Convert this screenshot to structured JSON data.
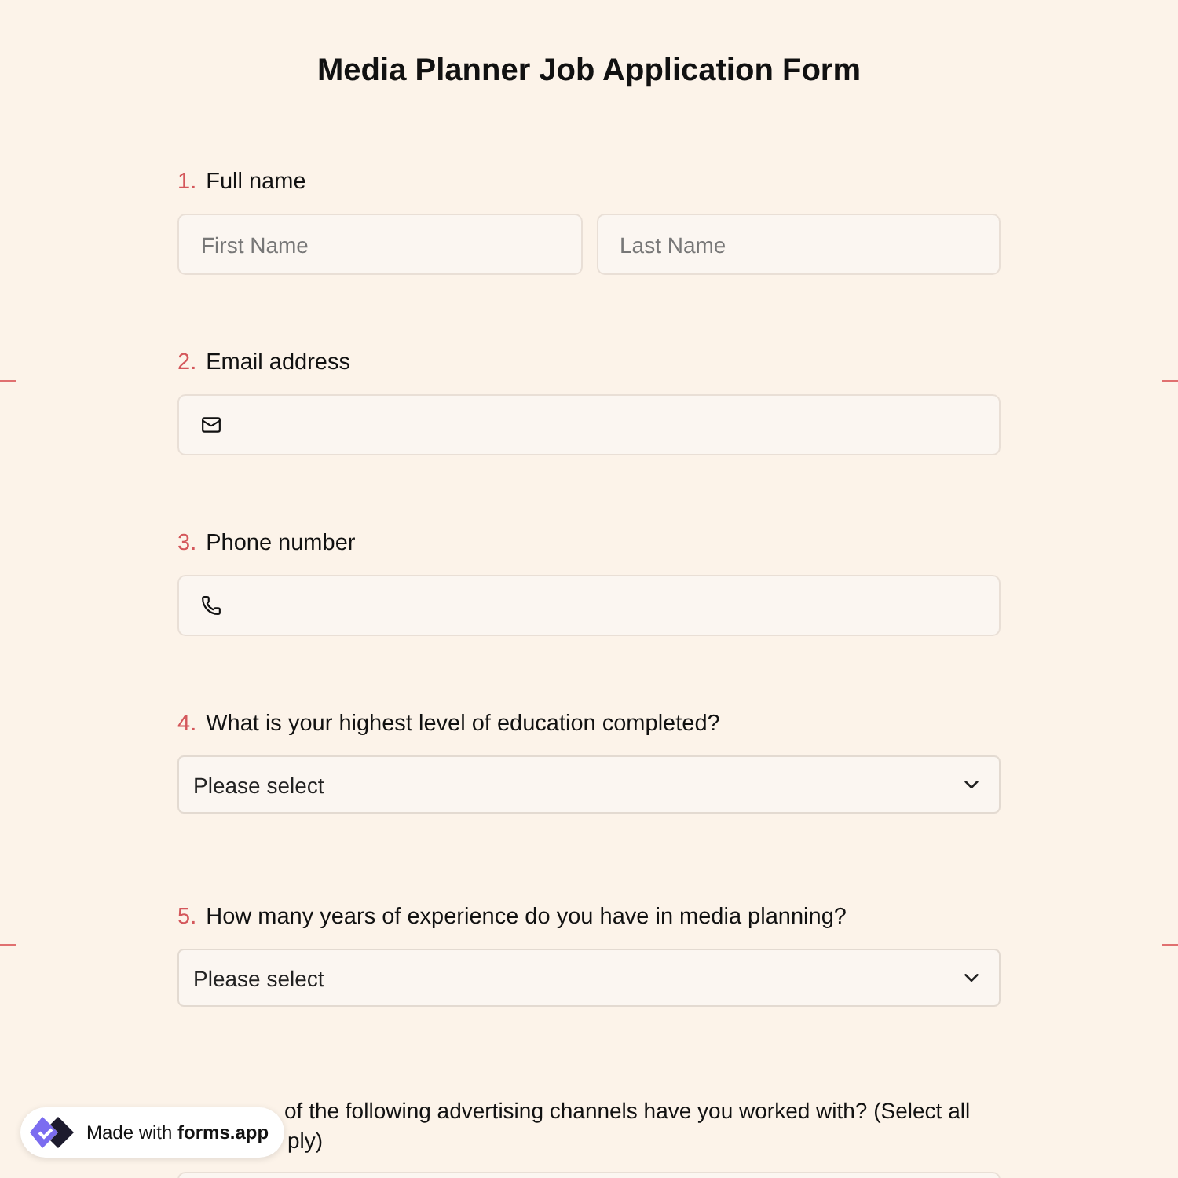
{
  "title": "Media Planner Job Application Form",
  "questions": [
    {
      "number": "1.",
      "label": "Full name",
      "kind": "name",
      "fields": [
        {
          "placeholder": "First Name"
        },
        {
          "placeholder": "Last Name"
        }
      ]
    },
    {
      "number": "2.",
      "label": "Email address",
      "kind": "email"
    },
    {
      "number": "3.",
      "label": "Phone number",
      "kind": "phone"
    },
    {
      "number": "4.",
      "label": "What is your highest level of education completed?",
      "kind": "select",
      "value": "Please select"
    },
    {
      "number": "5.",
      "label": "How many years of experience do you have in media planning?",
      "kind": "select",
      "value": "Please select"
    },
    {
      "kind": "checkboxes",
      "label_lines": [
        "of the following advertising channels have you worked with? (Select all",
        "ply)"
      ]
    }
  ],
  "badge": {
    "prefix": "Made with",
    "brand": "forms.app"
  }
}
